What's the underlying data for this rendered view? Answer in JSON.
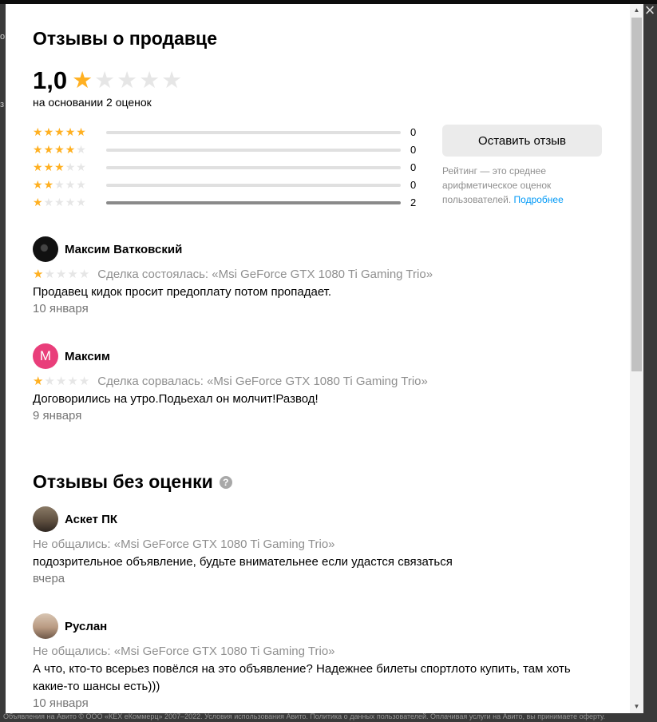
{
  "background": {
    "left_letter_1": "о",
    "left_letter_2": "з",
    "footer_text": "Объявления на Авито © ООО «КЕХ еКоммерц» 2007–2022. Условия использования Авито. Политика о данных пользователей. Оплачивая услуги на Авито, вы принимаете оферту."
  },
  "modal": {
    "close_icon": "×",
    "title": "Отзывы о продавце",
    "rating": {
      "value": "1,0",
      "stars_filled": 1,
      "stars_total": 5,
      "basis": "на основании 2 оценок"
    },
    "distribution": [
      {
        "stars": 5,
        "count": "0",
        "fraction": 0
      },
      {
        "stars": 4,
        "count": "0",
        "fraction": 0
      },
      {
        "stars": 3,
        "count": "0",
        "fraction": 0
      },
      {
        "stars": 2,
        "count": "0",
        "fraction": 0
      },
      {
        "stars": 1,
        "count": "2",
        "fraction": 1
      }
    ],
    "leave_review_label": "Оставить отзыв",
    "rating_note": "Рейтинг — это среднее арифметическое оценок пользователей.",
    "rating_note_link": "Подробнее",
    "reviews": [
      {
        "name": "Максим Ватковский",
        "avatar": "camera-avatar",
        "avatar_letter": "",
        "stars": 1,
        "deal": "Сделка состоялась: «Msi GeForce GTX 1080 Ti Gaming Trio»",
        "text": "Продавец кидок просит предоплату потом пропадает.",
        "date": "10 января"
      },
      {
        "name": "Максим",
        "avatar": "letter-avatar",
        "avatar_letter": "М",
        "stars": 1,
        "deal": "Сделка сорвалась: «Msi GeForce GTX 1080 Ti Gaming Trio»",
        "text": "Договорились на утро.Подьехал он молчит!Развод!",
        "date": "9 января"
      }
    ],
    "unrated_title": "Отзывы без оценки",
    "help_icon": "?",
    "unrated_reviews": [
      {
        "name": "Аскет ПК",
        "deal": "Не общались: «Msi GeForce GTX 1080 Ti Gaming Trio»",
        "text": "подозрительное объявление, будьте внимательнее если удастся связаться",
        "date": "вчера"
      },
      {
        "name": "Руслан",
        "deal": "Не общались: «Msi GeForce GTX 1080 Ti Gaming Trio»",
        "text": "А что, кто-то всерьез повёлся на это объявление? Надежнее билеты спортлото купить, там хоть какие-то шансы есть)))",
        "date": "10 января"
      }
    ]
  },
  "colors": {
    "star_on": "#ffb021",
    "star_off": "#e6e6e6",
    "link": "#0099f7",
    "avatar_pink": "#e93e7a"
  }
}
